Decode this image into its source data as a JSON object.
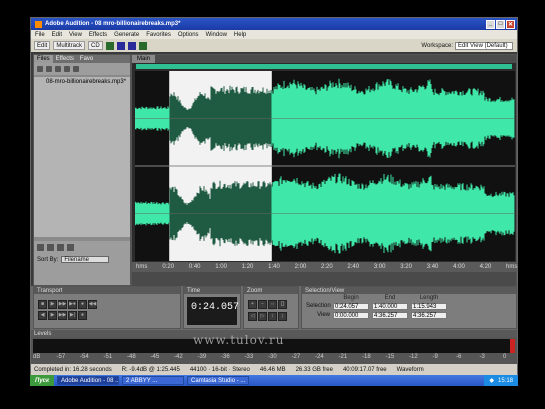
{
  "window": {
    "title": "Adobe Audition - 08 mro-billionairebreaks.mp3*",
    "controls": [
      "_",
      "□",
      "✕"
    ]
  },
  "menu": [
    "File",
    "Edit",
    "View",
    "Effects",
    "Generate",
    "Favorites",
    "Options",
    "Window",
    "Help"
  ],
  "toolbar": {
    "edit_label": "Edit",
    "multitrack_label": "Multitrack",
    "cd_label": "CD",
    "workspace_label": "Workspace:",
    "workspace_value": "Edit View (Default)"
  },
  "files_panel": {
    "tabs": [
      "Files",
      "Effects",
      "Favo"
    ],
    "file_name": "08-mro-billionairebreaks.mp3*",
    "sort_label": "Sort By:",
    "sort_value": "Filename"
  },
  "editor": {
    "tab_label": "Main",
    "timeline_ticks": [
      "hms",
      "0:20",
      "0:40",
      "1:00",
      "1:20",
      "1:40",
      "2:00",
      "2:20",
      "2:40",
      "3:00",
      "3:20",
      "3:40",
      "4:00",
      "4:20",
      "hms"
    ],
    "selection_fraction": [
      0.09,
      0.36
    ],
    "wave_color": "#3fe7a8",
    "selection_bg": "#f2f2f2",
    "selected_wave_color": "#1f5a42"
  },
  "transport": {
    "header": "Transport",
    "buttons": [
      "■",
      "▶",
      "▶▶",
      "▶●",
      "●",
      "◀◀",
      "◀",
      "▶",
      "▶▶",
      "▶|",
      "●"
    ]
  },
  "time": {
    "header": "Time",
    "value": "0:24.057"
  },
  "zoom": {
    "header": "Zoom"
  },
  "selection_view": {
    "header": "Selection/View",
    "col_begin": "Begin",
    "col_end": "End",
    "col_length": "Length",
    "row_selection": "Selection",
    "row_view": "View",
    "selection": [
      "0:24.057",
      "1:40.000",
      "1:15.943"
    ],
    "view": [
      "0:00.000",
      "4:36.257",
      "4:36.257"
    ]
  },
  "levels": {
    "header": "Levels",
    "scale": [
      "dB",
      "-57",
      "-54",
      "-51",
      "-48",
      "-45",
      "-42",
      "-39",
      "-36",
      "-33",
      "-30",
      "-27",
      "-24",
      "-21",
      "-18",
      "-15",
      "-12",
      "-9",
      "-6",
      "-3",
      "0"
    ]
  },
  "status": {
    "completed": "Completed in: 16.28 seconds",
    "rms": "R: -9.4dB @ 1:25.445",
    "format": "44100 · 16-bit · Stereo",
    "size": "46.46 MB",
    "free": "26.33 GB free",
    "free_time": "40:09:17.07 free",
    "mode": "Waveform"
  },
  "watermark": "www.tulov.ru",
  "taskbar": {
    "start": "Пуск",
    "tasks": [
      "Adobe Audition - 08 ...",
      "2 ABBYY ...",
      "Camtasia Studio - ..."
    ],
    "clock": "15:18"
  }
}
